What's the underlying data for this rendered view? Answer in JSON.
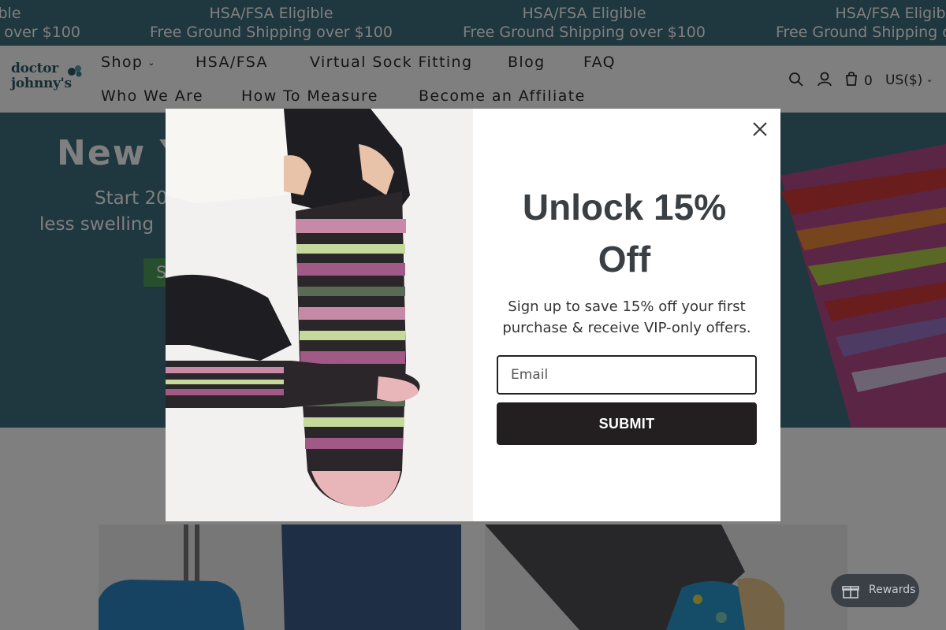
{
  "announcement": {
    "hsa_text": "HSA/FSA Eligible",
    "shipping_text": "Free Ground Shipping over $100"
  },
  "header": {
    "logo_line1": "doctor",
    "logo_line2": "johnny's",
    "nav": {
      "shop": "Shop",
      "hsa_fsa": "HSA/FSA",
      "virtual_fitting": "Virtual Sock Fitting",
      "blog": "Blog",
      "faq": "FAQ",
      "who_we_are": "Who We Are",
      "how_to_measure": "How To Measure",
      "affiliate": "Become an Affiliate"
    },
    "cart_count": "0",
    "currency": "US($)"
  },
  "hero": {
    "title": "New Y",
    "sub1": "Start 20",
    "sub2": "less swelling",
    "button": "S"
  },
  "modal": {
    "heading_line1": "Unlock 15%",
    "heading_line2": "Off",
    "text": "Sign up to save 15% off your first purchase & receive VIP-only offers.",
    "email_placeholder": "Email",
    "submit_label": "SUBMIT"
  },
  "rewards": {
    "label": "Rewards"
  },
  "colors": {
    "brand_teal": "#3f6f7f",
    "button_dark": "#231f20",
    "hero_button_green": "#4f9f5a"
  }
}
